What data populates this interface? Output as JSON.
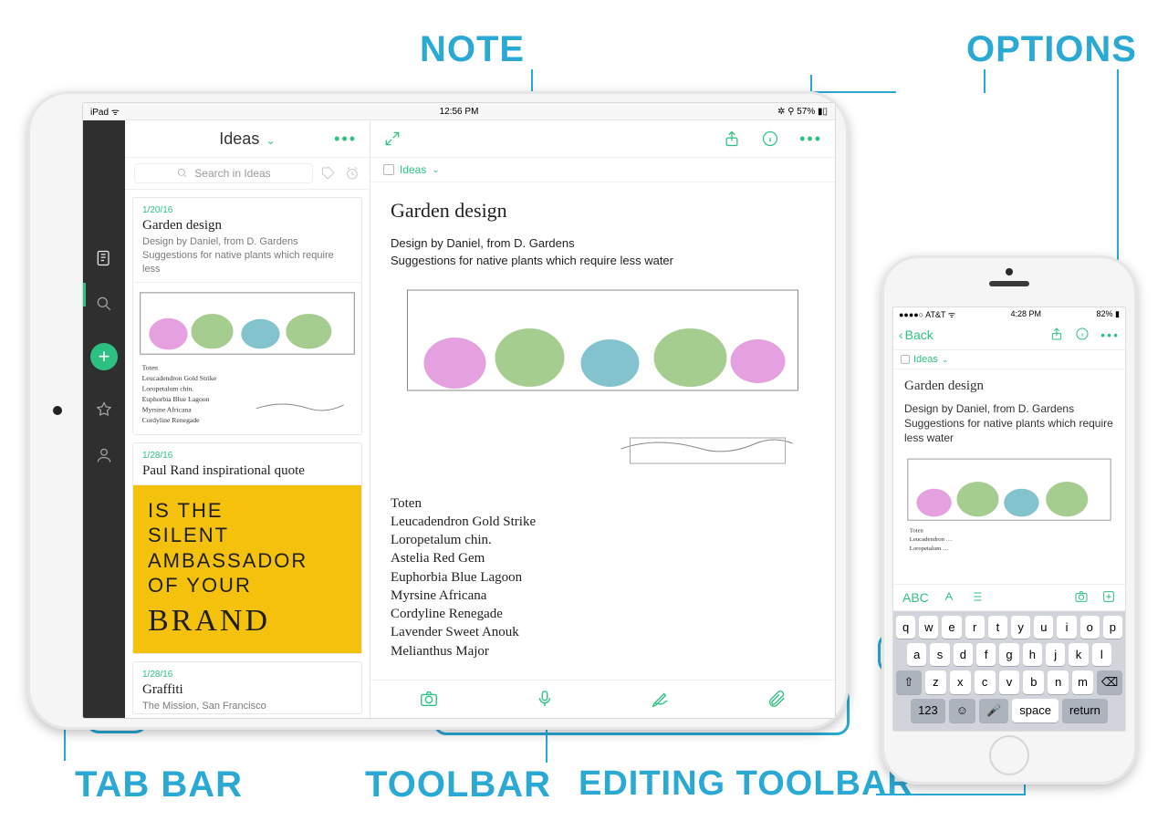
{
  "annotations": {
    "note": "NOTE",
    "options": "OPTIONS",
    "toolbar": "TOOLBAR",
    "tabbar": "TAB BAR",
    "editing_toolbar": "EDITING TOOLBAR"
  },
  "ipad": {
    "status": {
      "left": "iPad ᯤ",
      "center": "12:56 PM",
      "right": "✲ ⚲ 57% ▮▯"
    },
    "list": {
      "title": "Ideas",
      "more": "•••",
      "search_placeholder": "Search in Ideas",
      "items": [
        {
          "date": "1/20/16",
          "title": "Garden design",
          "snippet": "Design by Daniel, from D. Gardens\nSuggestions for native plants which require less",
          "thumb": "sketch"
        },
        {
          "date": "1/28/16",
          "title": "Paul Rand inspirational quote",
          "brand_lines": [
            "IS THE",
            "SILENT",
            "AMBASSADOR",
            "OF YOUR"
          ],
          "brand_serif": "BRAND"
        },
        {
          "date": "1/28/16",
          "title": "Graffiti",
          "snippet": "The Mission, San Francisco"
        }
      ]
    },
    "note": {
      "crumb": "Ideas",
      "title": "Garden design",
      "line1": "Design by Daniel, from D. Gardens",
      "line2": "Suggestions for native plants which require less water",
      "handwritten": [
        "Toten",
        "Leucadendron Gold Strike",
        "Loropetalum chin.",
        "Astelia Red Gem",
        "Euphorbia Blue Lagoon",
        "Myrsine Africana",
        "Cordyline Renegade",
        "Lavender Sweet Anouk",
        "Melianthus Major"
      ]
    },
    "toolbar_icons": [
      "camera",
      "mic",
      "pen",
      "attach"
    ]
  },
  "iphone": {
    "status": {
      "left": "●●●●○ AT&T ᯤ",
      "center": "4:28 PM",
      "right": "82% ▮"
    },
    "nav": {
      "back": "Back",
      "more": "•••"
    },
    "crumb": "Ideas",
    "note": {
      "title": "Garden design",
      "line1": "Design by Daniel, from D. Gardens",
      "line2": "Suggestions for native plants which require less water"
    },
    "edit_abc": "ABC",
    "keyboard": {
      "r1": [
        "q",
        "w",
        "e",
        "r",
        "t",
        "y",
        "u",
        "i",
        "o",
        "p"
      ],
      "r2": [
        "a",
        "s",
        "d",
        "f",
        "g",
        "h",
        "j",
        "k",
        "l"
      ],
      "r3_shift": "⇧",
      "r3": [
        "z",
        "x",
        "c",
        "v",
        "b",
        "n",
        "m"
      ],
      "r3_del": "⌫",
      "r4": {
        "num": "123",
        "emoji": "☺",
        "mic": "🎤",
        "space": "space",
        "return": "return"
      }
    }
  }
}
